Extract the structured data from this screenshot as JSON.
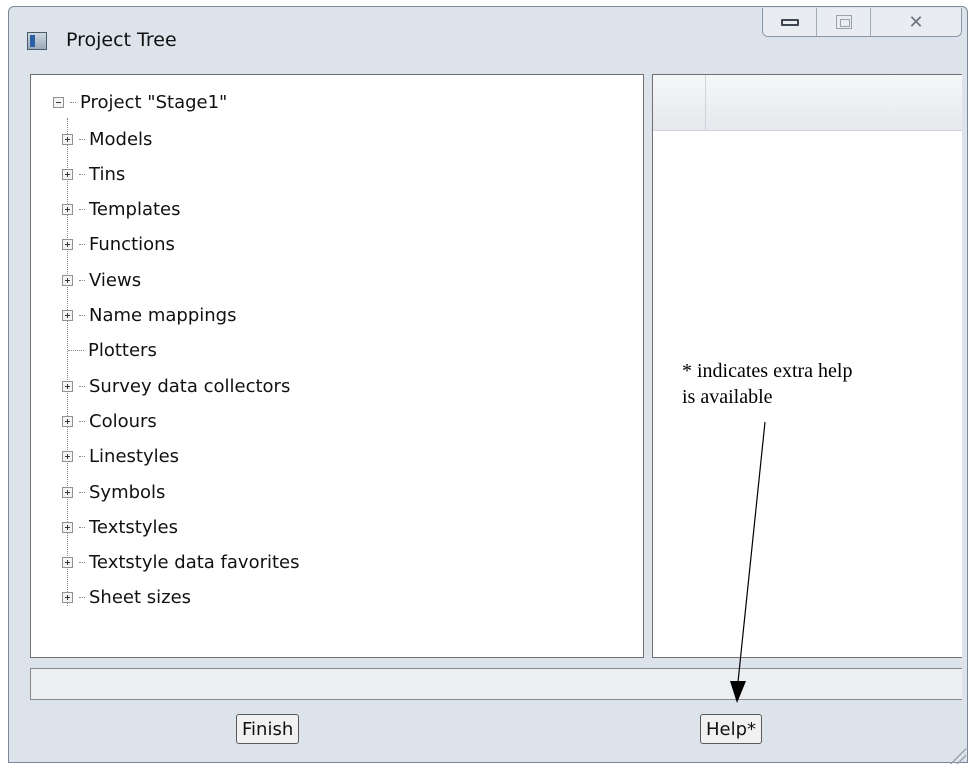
{
  "window": {
    "title": "Project Tree",
    "controls": {
      "minimize": "minimize",
      "maximize": "maximize",
      "close": "✕"
    }
  },
  "tree": {
    "root": {
      "label": "Project \"Stage1\"",
      "state": "expanded"
    },
    "children": [
      {
        "label": "Models",
        "expander": "plus"
      },
      {
        "label": "Tins",
        "expander": "plus"
      },
      {
        "label": "Templates",
        "expander": "plus"
      },
      {
        "label": "Functions",
        "expander": "plus"
      },
      {
        "label": "Views",
        "expander": "plus"
      },
      {
        "label": "Name mappings",
        "expander": "plus"
      },
      {
        "label": "Plotters",
        "expander": "none"
      },
      {
        "label": "Survey data collectors",
        "expander": "plus"
      },
      {
        "label": "Colours",
        "expander": "plus"
      },
      {
        "label": "Linestyles",
        "expander": "plus"
      },
      {
        "label": "Symbols",
        "expander": "plus"
      },
      {
        "label": "Textstyles",
        "expander": "plus"
      },
      {
        "label": "Textstyle data favorites",
        "expander": "plus"
      },
      {
        "label": "Sheet sizes",
        "expander": "plus"
      }
    ]
  },
  "status_bar": {
    "text": ""
  },
  "buttons": {
    "finish": "Finish",
    "help": "Help*"
  },
  "annotation": {
    "line1": "* indicates extra help",
    "line2": "is available"
  }
}
